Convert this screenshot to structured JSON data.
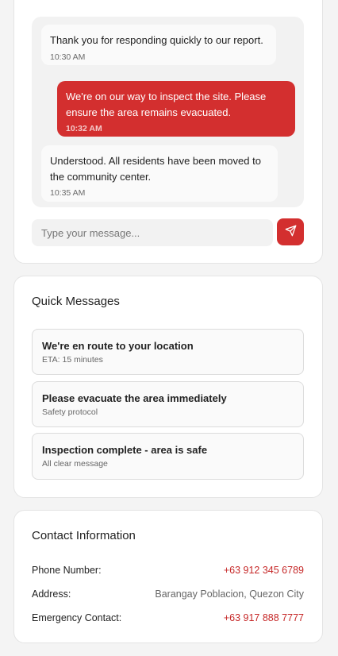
{
  "chat": {
    "messages": [
      {
        "direction": "in",
        "text": "Thank you for responding quickly to our report.",
        "time": "10:30 AM"
      },
      {
        "direction": "out",
        "text": "We're on our way to inspect the site. Please ensure the area remains evacuated.",
        "time": "10:32 AM"
      },
      {
        "direction": "in",
        "text": "Understood. All residents have been moved to the community center.",
        "time": "10:35 AM"
      }
    ],
    "input_placeholder": "Type your message...",
    "input_value": "",
    "send_icon": "send-icon"
  },
  "quick_messages": {
    "title": "Quick Messages",
    "items": [
      {
        "title": "We're en route to your location",
        "subtitle": "ETA: 15 minutes"
      },
      {
        "title": "Please evacuate the area immediately",
        "subtitle": "Safety protocol"
      },
      {
        "title": "Inspection complete - area is safe",
        "subtitle": "All clear message"
      }
    ]
  },
  "contact": {
    "title": "Contact Information",
    "rows": [
      {
        "label": "Phone Number:",
        "value": "+63 912 345 6789"
      },
      {
        "label": "Address:",
        "value": "Barangay Poblacion, Quezon City"
      },
      {
        "label": "Emergency Contact:",
        "value": "+63 917 888 7777"
      }
    ]
  },
  "colors": {
    "accent": "#d32f2f",
    "link": "#c62828",
    "background": "#f4f4f4",
    "card": "#ffffff"
  }
}
